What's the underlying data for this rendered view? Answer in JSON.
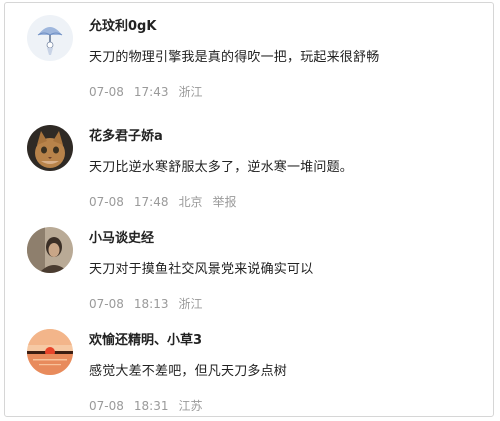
{
  "comments": [
    {
      "username": "允玟利0gK",
      "content": "天刀的物理引擎我是真的得吹一把，玩起来很舒畅",
      "date": "07-08",
      "time": "17:43",
      "location": "浙江",
      "avatar_icon": "parasol-drawing-avatar"
    },
    {
      "username": "花多君子娇a",
      "content": "天刀比逆水寒舒服太多了，逆水寒一堆问题。",
      "date": "07-08",
      "time": "17:48",
      "location": "北京",
      "report": "举报",
      "avatar_icon": "cat-photo-avatar"
    },
    {
      "username": "小马谈史经",
      "content": "天刀对于摸鱼社交风景党来说确实可以",
      "date": "07-08",
      "time": "18:13",
      "location": "浙江",
      "avatar_icon": "portrait-photo-avatar"
    },
    {
      "username": "欢愉还精明、小草3",
      "content": "感觉大差不差吧，但凡天刀多点树",
      "date": "07-08",
      "time": "18:31",
      "location": "江苏",
      "avatar_icon": "sunset-photo-avatar"
    }
  ]
}
